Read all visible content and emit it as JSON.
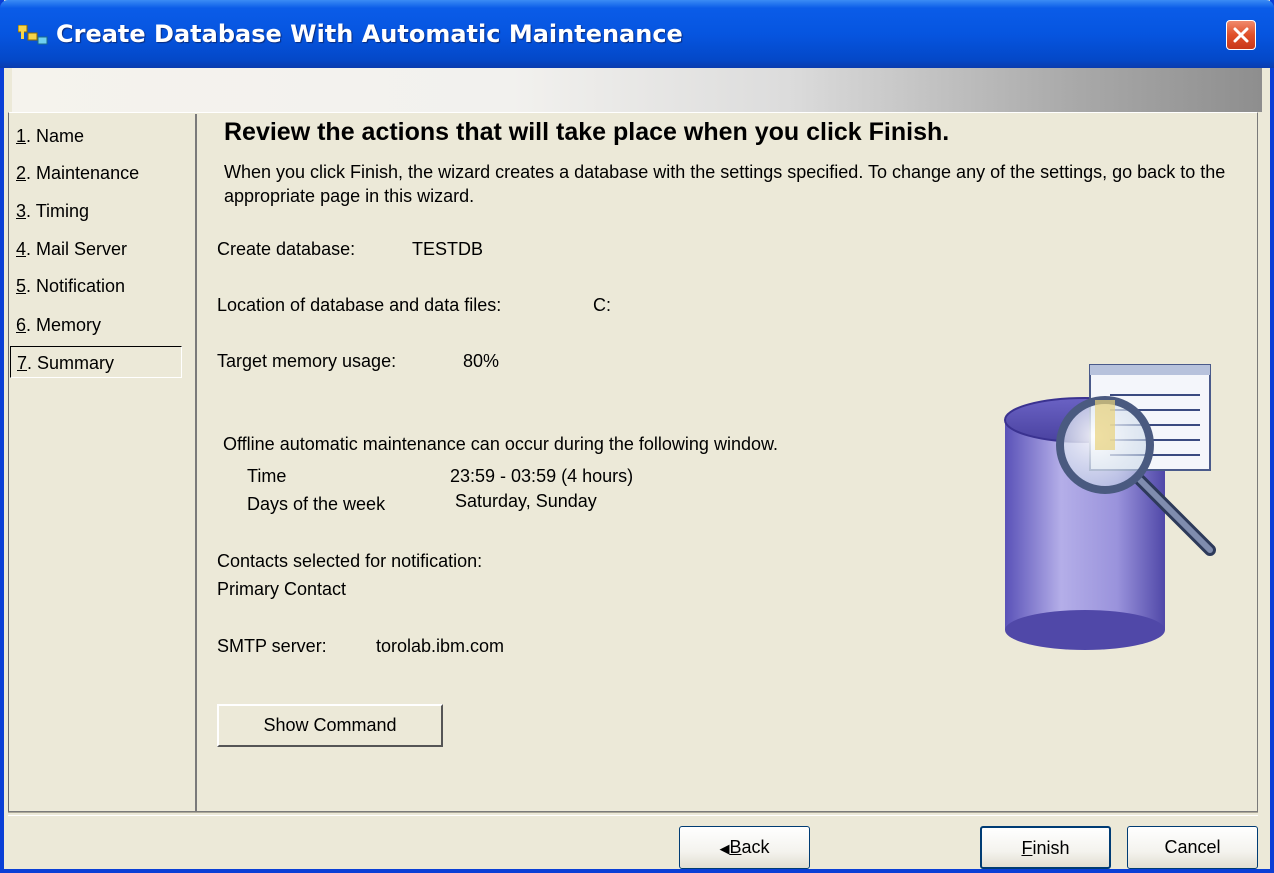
{
  "window": {
    "title": "Create Database With Automatic Maintenance",
    "app_icon": "db2-wizard-icon",
    "close_icon": "close-icon"
  },
  "steps": [
    {
      "num": "1",
      "label": ". Name",
      "active": false
    },
    {
      "num": "2",
      "label": ". Maintenance",
      "active": false
    },
    {
      "num": "3",
      "label": ". Timing",
      "active": false
    },
    {
      "num": "4",
      "label": ". Mail Server",
      "active": false
    },
    {
      "num": "5",
      "label": ". Notification",
      "active": false
    },
    {
      "num": "6",
      "label": ". Memory",
      "active": false
    },
    {
      "num": "7",
      "label": ". Summary",
      "active": true
    }
  ],
  "summary": {
    "heading": "Review the actions that will take place when you click Finish.",
    "description": "When you click Finish, the wizard creates a database with the settings specified. To change any of the settings, go back to the appropriate page in this wizard.",
    "create_db_label": "Create database:",
    "create_db_value": "TESTDB",
    "location_label": "Location of database and data files:",
    "location_value": "C:",
    "memory_label": "Target memory usage:",
    "memory_value": "80%",
    "offline_text": "Offline automatic maintenance can occur during the following window.",
    "time_label": "Time",
    "time_value": "23:59 - 03:59 (4 hours)",
    "days_label": "Days of the week",
    "days_value": "Saturday, Sunday",
    "contacts_label": "Contacts selected for notification:",
    "contacts_value": "Primary Contact",
    "smtp_label": "SMTP server:",
    "smtp_value": "torolab.ibm.com",
    "show_command_label": "Show Command"
  },
  "footer": {
    "back_label": "Back",
    "back_mnemonic": "B",
    "back_rest": "ack",
    "finish_mnemonic": "F",
    "finish_rest": "inish",
    "cancel_label": "Cancel"
  },
  "colors": {
    "title_bar": "#0655e0",
    "window_bg": "#ece9d8",
    "close_button": "#e0502a"
  }
}
